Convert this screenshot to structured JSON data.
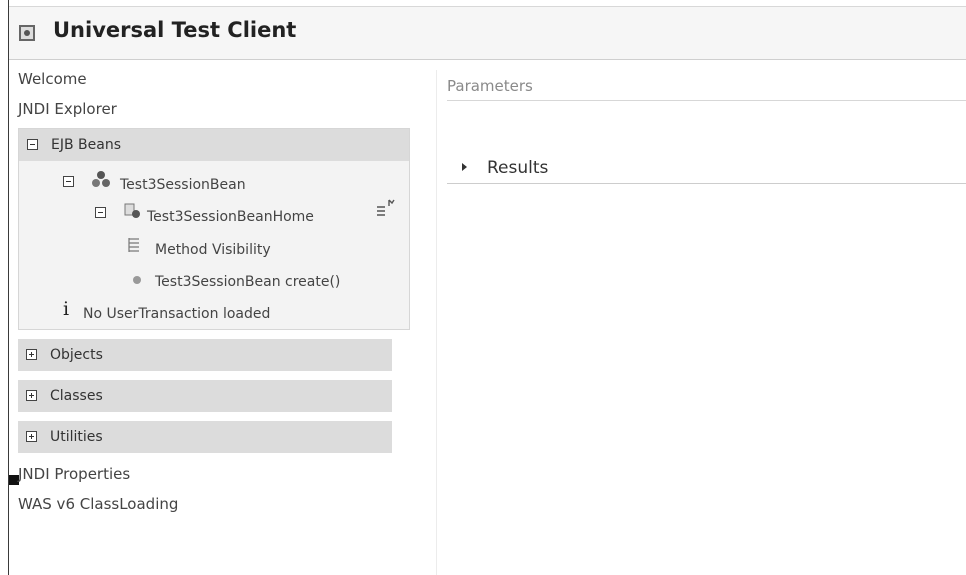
{
  "app": {
    "title": "Universal Test Client"
  },
  "nav": {
    "welcome": "Welcome",
    "jndi_explorer": "JNDI Explorer",
    "jndi_properties": "JNDI Properties",
    "was_classloading": "WAS v6 ClassLoading"
  },
  "ejb_panel": {
    "label": "EJB Beans",
    "bean": "Test3SessionBean",
    "home": "Test3SessionBeanHome",
    "method_visibility": "Method Visibility",
    "create_method": "Test3SessionBean create()",
    "info": "No UserTransaction loaded"
  },
  "collapsed_panels": {
    "objects": "Objects",
    "classes": "Classes",
    "utilities": "Utilities"
  },
  "main": {
    "parameters": "Parameters",
    "results": "Results"
  },
  "icons": {
    "title": "window-icon",
    "bean": "session-bean-icon",
    "home": "home-interface-icon",
    "method_visibility": "method-visibility-icon",
    "method": "method-icon",
    "info": "info-icon",
    "results_toggle": "triangle-right-icon"
  }
}
